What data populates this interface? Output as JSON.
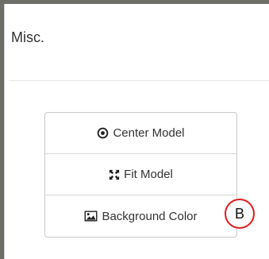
{
  "panel": {
    "heading": "Misc."
  },
  "buttons": [
    {
      "label": "Center Model",
      "icon": "dot-circle-icon"
    },
    {
      "label": "Fit Model",
      "icon": "expand-arrows-icon"
    },
    {
      "label": "Background Color",
      "icon": "image-icon"
    }
  ],
  "annotation": {
    "badge_label": "B",
    "badge_color": "#e01b1b"
  }
}
